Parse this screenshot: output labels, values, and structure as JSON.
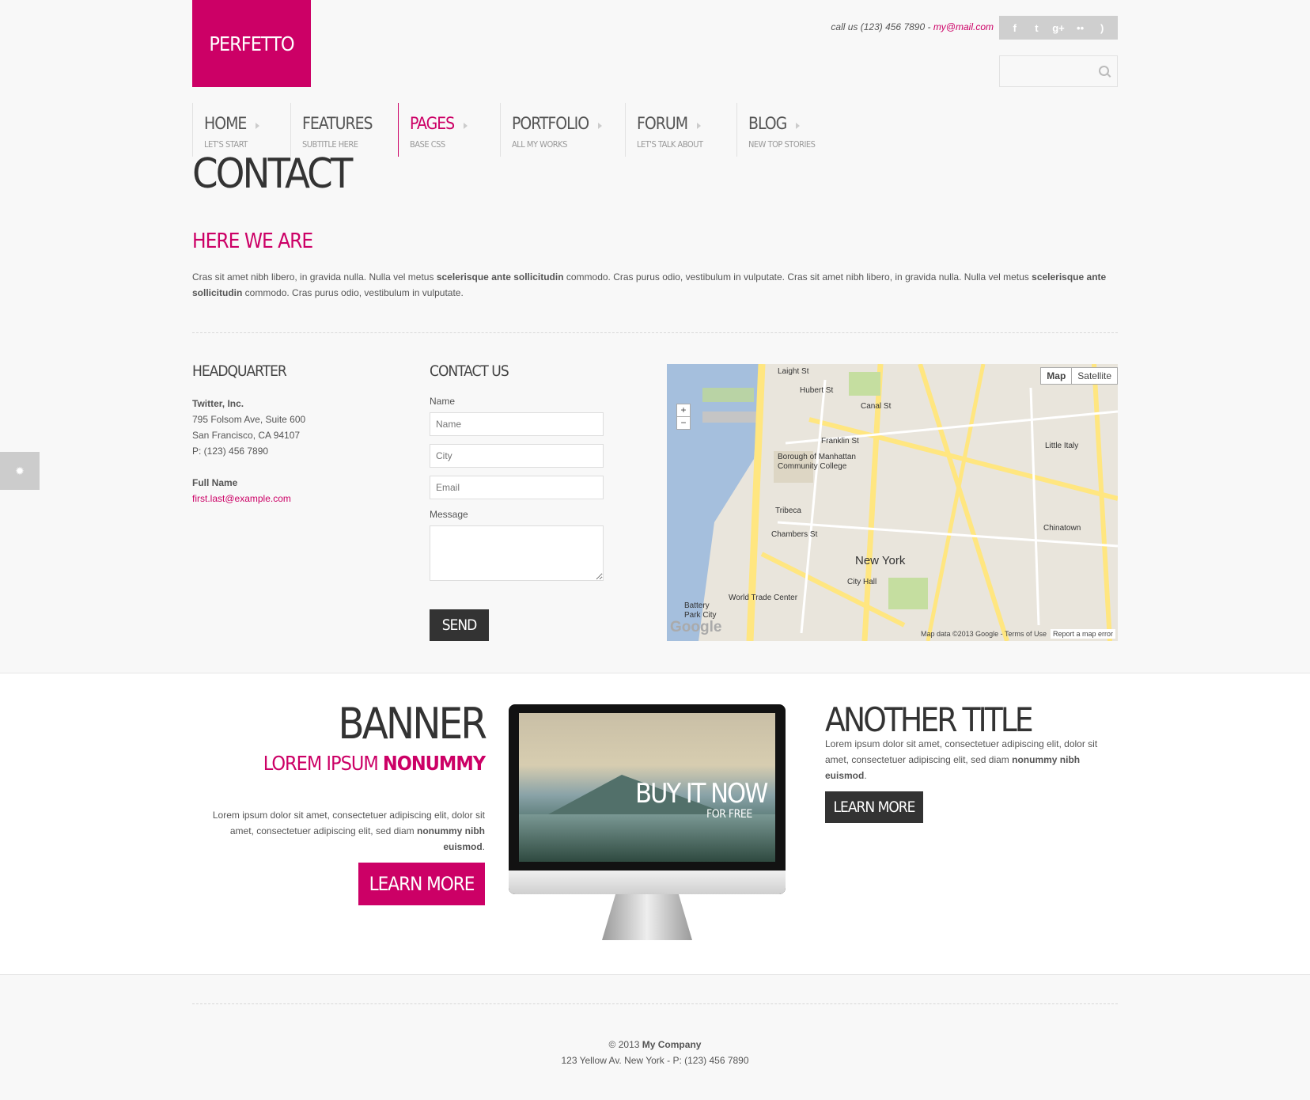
{
  "header": {
    "logo": "PERFETTO",
    "call_prefix": "call us (123) 456 7890 - ",
    "email": "my@mail.com",
    "social": [
      {
        "icon": "facebook-icon",
        "glyph": "f"
      },
      {
        "icon": "twitter-icon",
        "glyph": "t"
      },
      {
        "icon": "googleplus-icon",
        "glyph": "g+"
      },
      {
        "icon": "flickr-icon",
        "glyph": "••"
      },
      {
        "icon": "rss-icon",
        "glyph": ")"
      }
    ]
  },
  "nav": [
    {
      "label": "HOME",
      "sub": "LET'S START"
    },
    {
      "label": "FEATURES",
      "sub": "SUBTITLE HERE"
    },
    {
      "label": "PAGES",
      "sub": "BASE CSS"
    },
    {
      "label": "PORTFOLIO",
      "sub": "ALL MY WORKS"
    },
    {
      "label": "FORUM",
      "sub": "LET'S TALK ABOUT"
    },
    {
      "label": "BLOG",
      "sub": "NEW TOP STORIES"
    }
  ],
  "page": {
    "title": "CONTACT",
    "section_title": "HERE WE ARE",
    "intro": {
      "p1": "Cras sit amet nibh libero, in gravida nulla. Nulla vel metus ",
      "b1": "scelerisque ante sollicitudin",
      "p2": " commodo. Cras purus odio, vestibulum in vulputate. Cras sit amet nibh libero, in gravida nulla. Nulla vel metus ",
      "b2": "scelerisque ante sollicitudin",
      "p3": " commodo. Cras purus odio, vestibulum in vulputate."
    }
  },
  "headquarter": {
    "heading": "HEADQUARTER",
    "company": "Twitter, Inc.",
    "street": "795 Folsom Ave, Suite 600",
    "city": "San Francisco, CA 94107",
    "phone": "P: (123) 456 7890",
    "name_label": "Full Name",
    "email": "first.last@example.com"
  },
  "contact_form": {
    "heading": "CONTACT US",
    "name_label": "Name",
    "name_placeholder": "Name",
    "city_placeholder": "City",
    "email_placeholder": "Email",
    "message_label": "Message",
    "send": "SEND"
  },
  "map": {
    "tab_map": "Map",
    "tab_satellite": "Satellite",
    "zoom_in": "+",
    "zoom_out": "−",
    "attribution": "Map data ©2013 Google - Terms of Use",
    "report": "Report a map error",
    "google": "Google",
    "labels": {
      "new_york": "New York",
      "tribeca": "Tribeca",
      "chinatown": "Chinatown",
      "little_italy": "Little Italy",
      "city_hall": "City Hall",
      "canal_st": "Canal St",
      "chambers_st": "Chambers St",
      "world_trade_center": "World Trade Center",
      "hubert_st": "Hubert St",
      "laight_st": "Laight St",
      "franklin_st": "Franklin St",
      "bmcc": "Borough of Manhattan Community College",
      "battery_park": "Battery Park City"
    }
  },
  "banner": {
    "title": "BANNER",
    "subtitle_plain": "LOREM IPSUM ",
    "subtitle_bold": "NONUMMY",
    "text": "Lorem ipsum dolor sit amet, consectetuer adipiscing elit, dolor sit amet, consectetuer adipiscing elit, sed diam ",
    "text_bold": "nonummy nibh euismod",
    "text_end": ".",
    "button": "LEARN MORE",
    "screen_title": "BUY IT NOW",
    "screen_sub": "FOR FREE"
  },
  "another": {
    "title": "ANOTHER TITLE",
    "text": "Lorem ipsum dolor sit amet, consectetuer adipiscing elit, dolor sit amet, consectetuer adipiscing elit, sed diam ",
    "text_bold": "nonummy nibh euismod",
    "text_end": ".",
    "button": "LEARN MORE"
  },
  "footer": {
    "copy": "© 2013 ",
    "company": "My Company",
    "address": "123 Yellow Av. New York - P: (123) 456 7890"
  },
  "colors": {
    "accent": "#cc0066",
    "dark": "#333333"
  }
}
